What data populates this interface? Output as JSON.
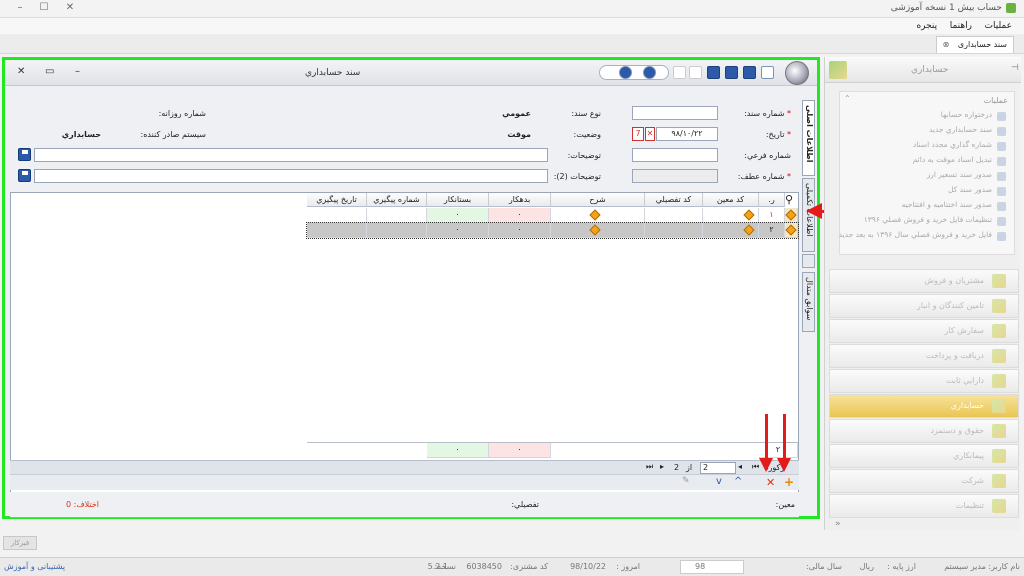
{
  "app": {
    "title": "حساب بیش 1 نسخه آموزشی",
    "minimize": "–",
    "maximize": "☐",
    "close": "✕"
  },
  "menu": [
    "عملیات",
    "راهنما",
    "پنجره"
  ],
  "doc_tab": {
    "label": "سند حسابداری",
    "close": "⊗"
  },
  "window": {
    "title": "سند حسابداري",
    "close": "✕",
    "restore": "▭",
    "minimize": "–"
  },
  "form": {
    "doc_number_label": "شماره سند:",
    "doc_type_label": "نوع سند:",
    "doc_type_value": "عمومي",
    "daily_number_label": "شماره روزانه:",
    "date_label": "تاريخ:",
    "date_value": "۹۸/۱۰/۲۲",
    "status_label": "وضعيت:",
    "status_value": "موقت",
    "issuer_label": "سيستم صادر کننده:",
    "issuer_value": "حسابداري",
    "sub_number_label": "شماره فرعي:",
    "desc_label": "توضيحات:",
    "desc2_label": "توضيحات (2):",
    "ref_number_label": "شماره عطف:",
    "required_mark": "*"
  },
  "side_tabs": [
    "اطلاعات اصلی",
    "اطلاعات تکمیلی",
    "یادداشت",
    "سوابق متدال"
  ],
  "grid": {
    "columns": [
      "ر.",
      "کد معين",
      "کد تفصيلي",
      "شرح",
      "بدهکار",
      "بستانکار",
      "شماره پيگيري",
      "تاريخ پيگيري"
    ],
    "rows": [
      {
        "num": "۱",
        "debit": "۰",
        "credit": "۰"
      },
      {
        "num": "۲",
        "debit": "۰",
        "credit": "۰"
      }
    ],
    "footer": {
      "num": "۲",
      "debit": "۰",
      "credit": "۰"
    }
  },
  "pager": {
    "label": "رکورد",
    "current": "2",
    "of": "از",
    "total": "2"
  },
  "footer": {
    "moein_label": "معين:",
    "tafsili_label": "تفصيلي:",
    "diff_label": "اختلاف:",
    "diff_value": "0"
  },
  "sidebar": {
    "header": "حسابداري",
    "ops_header": "عمليات",
    "ops": [
      "درختواره حسابها",
      "سند حسابداري جديد",
      "شماره گذاري مجدد اسناد",
      "تبديل اسناد موقت به دائم",
      "صدور سند تسعير ارز",
      "صدور سند کل",
      "صدور سند اختتاميه و افتتاحيه",
      "تنظيمات فايل خريد و فروش فصلي ۱۳۹۶",
      "فايل خريد و فروش فصلي سال ۱۳۹۶ به بعد جديد"
    ],
    "modules": [
      "مشتريان و فروش",
      "تامين کنندگان و انبار",
      "سفارش کار",
      "دريافت و پرداخت",
      "دارايي ثابت",
      "حسابداري",
      "حقوق و دستمزد",
      "پيمانکاري",
      "شرکت",
      "تنظيمات"
    ]
  },
  "status": {
    "user": "نام کاربر: مدیر سیستم",
    "base_currency": "ارز پایه :",
    "currency": "ریال",
    "fiscal_year_label": "سال مالی:",
    "fiscal_year": "98",
    "today_label": "امروز :",
    "today": "98/10/22",
    "customer_label": "کد مشتری:",
    "customer": "6038450",
    "version_label": "نسخه:",
    "version": "5.2.1",
    "support": "پشتیبانی و آموزش",
    "calc_btn": "فیزکار"
  },
  "colors": {
    "frame_highlight": "#22e822",
    "arrow": "#e31b1b",
    "active_module": "#e9c652"
  }
}
